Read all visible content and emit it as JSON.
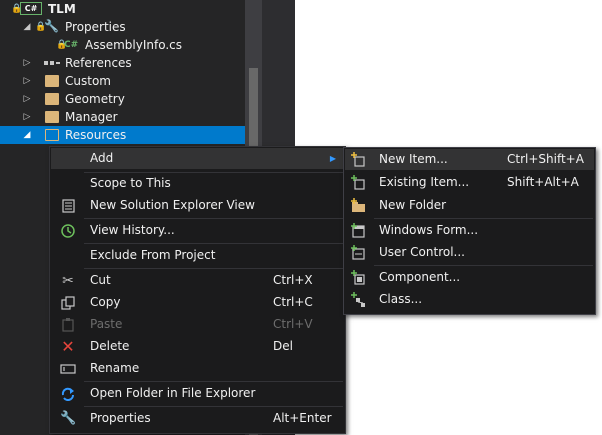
{
  "tree": {
    "project": "TLM",
    "items": [
      {
        "label": "Properties"
      },
      {
        "label": "AssemblyInfo.cs"
      },
      {
        "label": "References"
      },
      {
        "label": "Custom"
      },
      {
        "label": "Geometry"
      },
      {
        "label": "Manager"
      },
      {
        "label": "Resources"
      }
    ],
    "project_badge": "C#",
    "file_badge": "C#"
  },
  "context_menu": {
    "items": [
      {
        "label": "Add",
        "shortcut": ""
      },
      {
        "label": "Scope to This",
        "shortcut": ""
      },
      {
        "label": "New Solution Explorer View",
        "shortcut": ""
      },
      {
        "label": "View History...",
        "shortcut": ""
      },
      {
        "label": "Exclude From Project",
        "shortcut": ""
      },
      {
        "label": "Cut",
        "shortcut": "Ctrl+X"
      },
      {
        "label": "Copy",
        "shortcut": "Ctrl+C"
      },
      {
        "label": "Paste",
        "shortcut": "Ctrl+V"
      },
      {
        "label": "Delete",
        "shortcut": "Del"
      },
      {
        "label": "Rename",
        "shortcut": ""
      },
      {
        "label": "Open Folder in File Explorer",
        "shortcut": ""
      },
      {
        "label": "Properties",
        "shortcut": "Alt+Enter"
      }
    ]
  },
  "add_submenu": {
    "items": [
      {
        "label": "New Item...",
        "shortcut": "Ctrl+Shift+A"
      },
      {
        "label": "Existing Item...",
        "shortcut": "Shift+Alt+A"
      },
      {
        "label": "New Folder",
        "shortcut": ""
      },
      {
        "label": "Windows Form...",
        "shortcut": ""
      },
      {
        "label": "User Control...",
        "shortcut": ""
      },
      {
        "label": "Component...",
        "shortcut": ""
      },
      {
        "label": "Class...",
        "shortcut": ""
      }
    ]
  },
  "colors": {
    "selection": "#007acc",
    "menu_bg": "#1b1b1c",
    "highlight": "#333334",
    "folder": "#dcb67a"
  }
}
